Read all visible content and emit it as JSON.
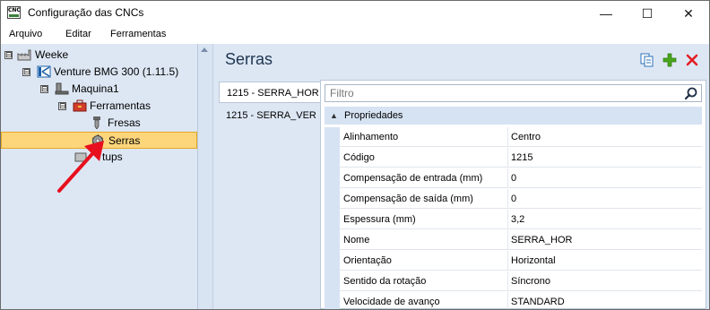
{
  "window": {
    "icon_text": "CNC",
    "title": "Configuração das CNCs",
    "min_glyph": "—",
    "max_glyph": "☐",
    "close_glyph": "✕"
  },
  "menu": [
    "Arquivo",
    "Editar",
    "Ferramentas"
  ],
  "tree": {
    "items": [
      {
        "label": "Weeke",
        "icon": "factory-icon",
        "expander": "⊟"
      },
      {
        "label": "Venture BMG 300 (1.11.5)",
        "icon": "cnc-machine-icon",
        "expander": "⊟"
      },
      {
        "label": "Maquina1",
        "icon": "machine-icon",
        "expander": "⊟"
      },
      {
        "label": "Ferramentas",
        "icon": "toolbox-icon",
        "expander": "⊟"
      },
      {
        "label": "Fresas",
        "icon": "drill-icon"
      },
      {
        "label": "Serras",
        "icon": "saw-blade-icon"
      },
      {
        "label": "tups",
        "icon": "setup-icon"
      }
    ]
  },
  "panel": {
    "title": "Serras",
    "toolbar": {
      "copy_icon": "copy-icon",
      "add_icon": "add-icon",
      "delete_icon": "delete-icon"
    },
    "tabs": [
      "1215 - SERRA_HOR",
      "1215 - SERRA_VER"
    ],
    "filter_placeholder": "Filtro",
    "group": {
      "label": "Propriedades",
      "chevron": "▲"
    },
    "properties": [
      {
        "name": "Alinhamento",
        "value": "Centro"
      },
      {
        "name": "Código",
        "value": "1215"
      },
      {
        "name": "Compensação de entrada (mm)",
        "value": "0"
      },
      {
        "name": "Compensação de saída (mm)",
        "value": "0"
      },
      {
        "name": "Espessura (mm)",
        "value": "3,2"
      },
      {
        "name": "Nome",
        "value": "SERRA_HOR"
      },
      {
        "name": "Orientação",
        "value": "Horizontal"
      },
      {
        "name": "Sentido da rotação",
        "value": "Síncrono"
      },
      {
        "name": "Velocidade de avanço",
        "value": "STANDARD"
      }
    ]
  },
  "colors": {
    "selection": "#fdd67c",
    "panel_bg": "#dde7f4",
    "annotation_arrow": "#e8101e"
  }
}
